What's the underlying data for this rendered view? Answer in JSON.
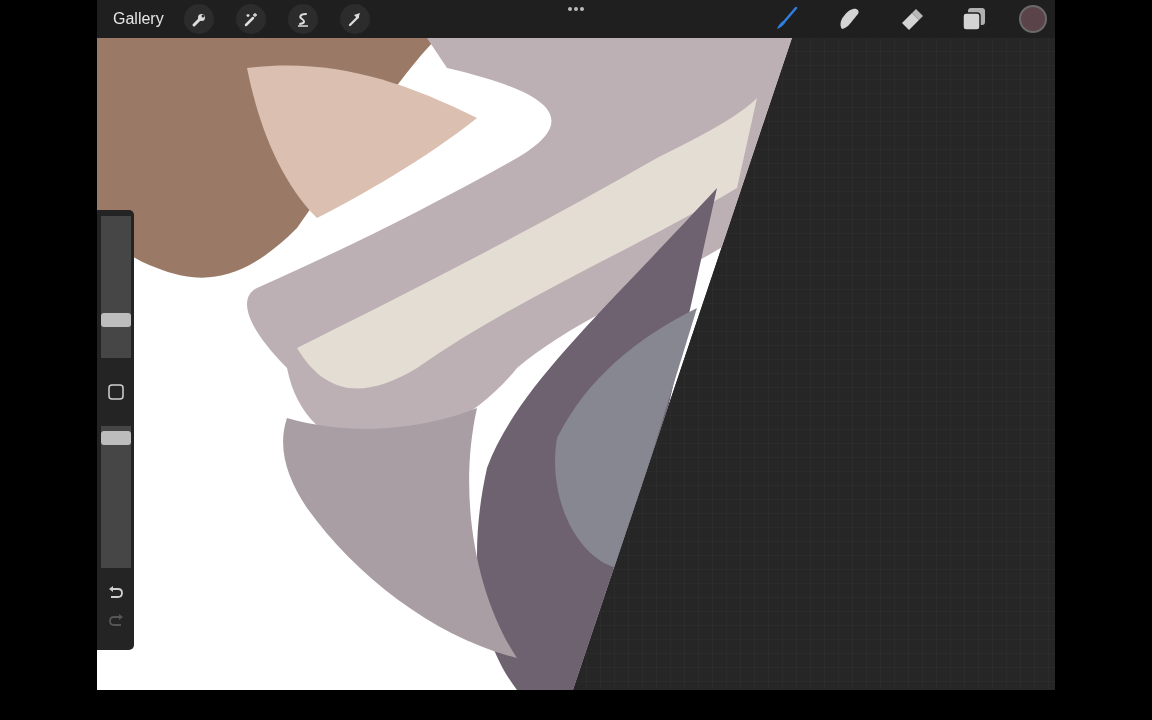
{
  "top_bar": {
    "gallery": "Gallery",
    "left_tools": [
      {
        "kind": "wrench"
      },
      {
        "kind": "wand"
      },
      {
        "kind": "selection"
      },
      {
        "kind": "transform"
      }
    ],
    "right_tools": [
      {
        "kind": "brush",
        "selected": true
      },
      {
        "kind": "smudge",
        "selected": false
      },
      {
        "kind": "eraser",
        "selected": false
      },
      {
        "kind": "layers",
        "selected": false
      }
    ],
    "color_swatch": {
      "color": "#5b4449"
    }
  },
  "sidebar": {
    "size_slider": {
      "level": 0.24
    },
    "opacity_slider": {
      "level": 0.96
    },
    "undo": {
      "disabled": false
    },
    "redo": {
      "disabled": true
    }
  }
}
